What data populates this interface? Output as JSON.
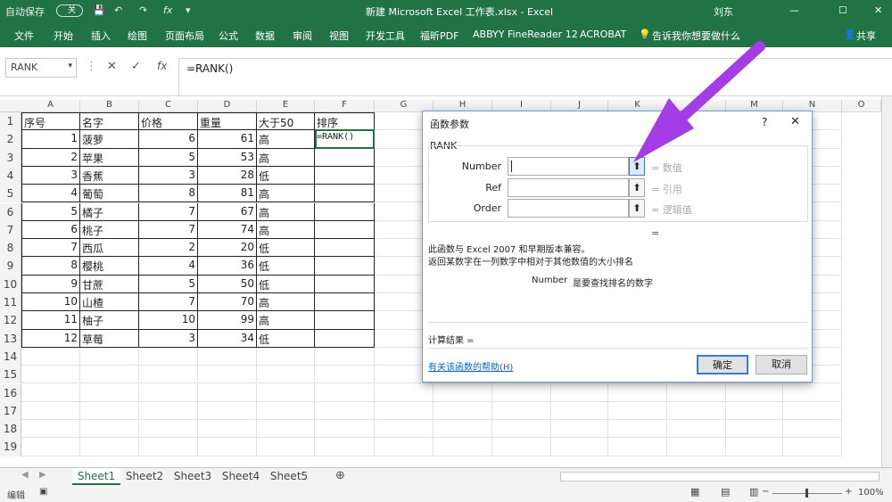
{
  "titlebar": {
    "autosave": "自动保存",
    "toggle": "关",
    "title": "新建 Microsoft Excel 工作表.xlsx - Excel",
    "user": "刘东"
  },
  "ribbon": {
    "tabs": [
      "文件",
      "开始",
      "插入",
      "绘图",
      "页面布局",
      "公式",
      "数据",
      "审阅",
      "视图",
      "开发工具",
      "福昕PDF",
      "ABBYY FineReader 12",
      "ACROBAT"
    ],
    "tell": "告诉我你想要做什么",
    "share": "共享"
  },
  "formula_bar": {
    "namebox": "RANK",
    "formula": "=RANK()"
  },
  "columns": [
    "A",
    "B",
    "C",
    "D",
    "E",
    "F",
    "G",
    "H",
    "I",
    "J",
    "K",
    "L",
    "M",
    "N",
    "O"
  ],
  "rows": [
    "1",
    "2",
    "3",
    "4",
    "5",
    "6",
    "7",
    "8",
    "9",
    "10",
    "11",
    "12",
    "13",
    "14",
    "15",
    "16",
    "17",
    "18",
    "19"
  ],
  "table": {
    "headers": [
      "序号",
      "名字",
      "价格",
      "重量",
      "大于50",
      "排序"
    ],
    "data": [
      [
        "1",
        "菠萝",
        "6",
        "61",
        "高",
        "=RANK()"
      ],
      [
        "2",
        "苹果",
        "5",
        "53",
        "高",
        ""
      ],
      [
        "3",
        "香蕉",
        "3",
        "28",
        "低",
        ""
      ],
      [
        "4",
        "葡萄",
        "8",
        "81",
        "高",
        ""
      ],
      [
        "5",
        "橘子",
        "7",
        "67",
        "高",
        ""
      ],
      [
        "6",
        "桃子",
        "7",
        "74",
        "高",
        ""
      ],
      [
        "7",
        "西瓜",
        "2",
        "20",
        "低",
        ""
      ],
      [
        "8",
        "樱桃",
        "4",
        "36",
        "低",
        ""
      ],
      [
        "9",
        "甘蔗",
        "5",
        "50",
        "低",
        ""
      ],
      [
        "10",
        "山楂",
        "7",
        "70",
        "高",
        ""
      ],
      [
        "11",
        "柚子",
        "10",
        "99",
        "高",
        ""
      ],
      [
        "12",
        "草莓",
        "3",
        "34",
        "低",
        ""
      ]
    ]
  },
  "dialog": {
    "title": "函数参数",
    "help_q": "?",
    "func": "RANK",
    "args": [
      {
        "label": "Number",
        "result": "= 数值"
      },
      {
        "label": "Ref",
        "result": "= 引用"
      },
      {
        "label": "Order",
        "result": "= 逻辑值"
      }
    ],
    "eq": "=",
    "desc1": "此函数与 Excel 2007 和早期版本兼容。",
    "desc2": "返回某数字在一列数字中相对于其他数值的大小排名",
    "arg_name": "Number",
    "arg_desc": "是要查找排名的数字",
    "result_label": "计算结果 =",
    "help_link": "有关该函数的帮助(H)",
    "ok": "确定",
    "cancel": "取消"
  },
  "sheet_tabs": [
    "Sheet1",
    "Sheet2",
    "Sheet3",
    "Sheet4",
    "Sheet5"
  ],
  "status": {
    "mode": "编辑",
    "zoom": "100%"
  },
  "colors": {
    "excel_green": "#217346",
    "arrow": "#a43de6"
  }
}
